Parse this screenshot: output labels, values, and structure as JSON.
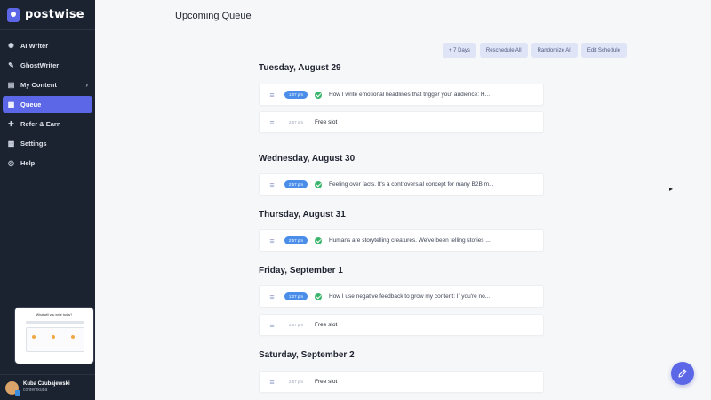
{
  "brand": {
    "name": "postwise"
  },
  "sidebar": {
    "items": [
      {
        "label": "AI Writer",
        "icon": "bulb-icon",
        "active": false
      },
      {
        "label": "GhostWriter",
        "icon": "ghost-icon",
        "active": false
      },
      {
        "label": "My Content",
        "icon": "folder-icon",
        "active": false,
        "has_chevron": true
      },
      {
        "label": "Queue",
        "icon": "calendar-icon",
        "active": true
      },
      {
        "label": "Refer & Earn",
        "icon": "gift-icon",
        "active": false
      },
      {
        "label": "Settings",
        "icon": "grid-icon",
        "active": false
      },
      {
        "label": "Help",
        "icon": "help-icon",
        "active": false
      }
    ],
    "preview": {
      "title": "What will you write today?"
    },
    "user": {
      "name": "Kuba Czubajewski",
      "handle": "contentkuba"
    }
  },
  "main": {
    "title": "Upcoming Queue",
    "actions": [
      "+ 7 Days",
      "Reschedule All",
      "Randomize All",
      "Edit Schedule"
    ],
    "days": [
      {
        "heading": "Tuesday, August 29",
        "slots": [
          {
            "time": "1:07 pm",
            "filled": true,
            "text": "How I write emotional headlines that trigger your audience: H..."
          },
          {
            "time": "2:57 pm",
            "filled": false,
            "text": "Free slot"
          }
        ]
      },
      {
        "heading": "Wednesday, August 30",
        "slots": [
          {
            "time": "2:57 pm",
            "filled": true,
            "text": "Feeling over facts. It's a controversial concept for many B2B m..."
          }
        ]
      },
      {
        "heading": "Thursday, August 31",
        "slots": [
          {
            "time": "2:57 pm",
            "filled": true,
            "text": "Humans are storytelling creatures. We've been telling stories ..."
          }
        ]
      },
      {
        "heading": "Friday, September 1",
        "slots": [
          {
            "time": "1:07 pm",
            "filled": true,
            "text": "How I use negative feedback to grow my content: If you're no..."
          },
          {
            "time": "2:57 pm",
            "filled": false,
            "text": "Free slot"
          }
        ]
      },
      {
        "heading": "Saturday, September 2",
        "slots": [
          {
            "time": "2:57 pm",
            "filled": false,
            "text": "Free slot"
          }
        ]
      }
    ]
  },
  "colors": {
    "accent": "#5b67e6",
    "sidebar_bg": "#1b2230",
    "time_pill": "#4a8eea",
    "success": "#3bb56c"
  }
}
